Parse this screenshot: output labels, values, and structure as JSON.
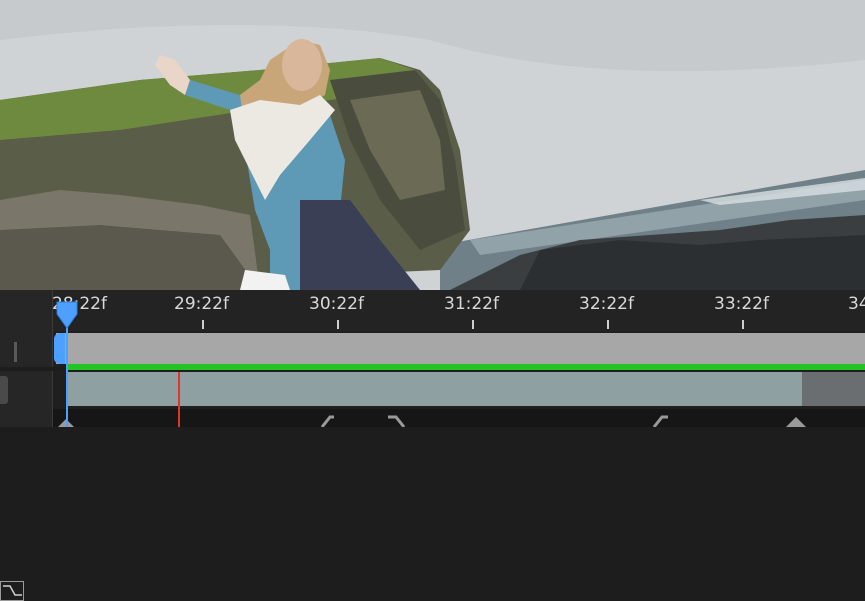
{
  "timeline": {
    "current_time": "28:22f",
    "ticks": [
      {
        "label": "29:22f"
      },
      {
        "label": "30:22f"
      },
      {
        "label": "31:22f"
      },
      {
        "label": "32:22f"
      },
      {
        "label": "33:22f"
      },
      {
        "label": "34"
      }
    ]
  },
  "colors": {
    "playhead": "#4ea0ff",
    "work_area": "#a7a7a7",
    "render_bar": "#25c425",
    "layer_bar": "#8fa0a2",
    "cut_marker": "#e0352b"
  },
  "icons": {
    "graph_editor": "graph-editor-icon",
    "playhead": "playhead-icon"
  }
}
